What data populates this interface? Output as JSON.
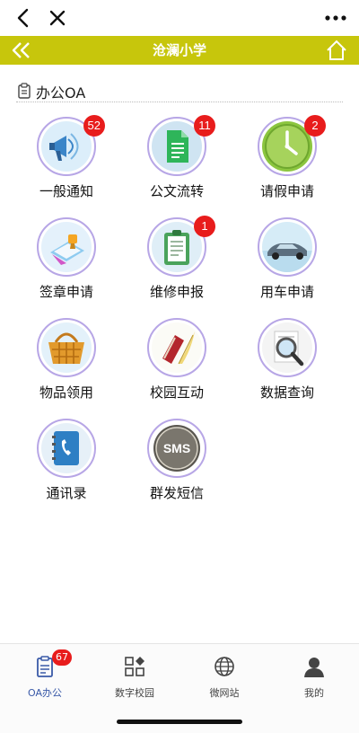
{
  "header": {
    "title": "沧澜小学"
  },
  "section": {
    "title": "办公OA"
  },
  "apps": [
    {
      "label": "一般通知",
      "badge": "52",
      "icon": "megaphone-icon"
    },
    {
      "label": "公文流转",
      "badge": "11",
      "icon": "document-icon"
    },
    {
      "label": "请假申请",
      "badge": "2",
      "icon": "clock-icon"
    },
    {
      "label": "签章申请",
      "badge": "",
      "icon": "stamp-icon"
    },
    {
      "label": "维修申报",
      "badge": "1",
      "icon": "clipboard-icon"
    },
    {
      "label": "用车申请",
      "badge": "",
      "icon": "car-icon"
    },
    {
      "label": "物品领用",
      "badge": "",
      "icon": "basket-icon"
    },
    {
      "label": "校园互动",
      "badge": "",
      "icon": "book-quill-icon"
    },
    {
      "label": "数据查询",
      "badge": "",
      "icon": "magnifier-icon"
    },
    {
      "label": "通讯录",
      "badge": "",
      "icon": "phonebook-icon"
    },
    {
      "label": "群发短信",
      "badge": "",
      "icon": "sms-icon"
    }
  ],
  "tabs": [
    {
      "label": "OA办公",
      "badge": "67",
      "active": true
    },
    {
      "label": "数字校园",
      "badge": ""
    },
    {
      "label": "微网站",
      "badge": ""
    },
    {
      "label": "我的",
      "badge": ""
    }
  ],
  "colors": {
    "titlebar": "#c7c60c",
    "badge": "#e81c1c",
    "circle_border": "#b7a6e6",
    "active_tab": "#3a5aa8"
  }
}
